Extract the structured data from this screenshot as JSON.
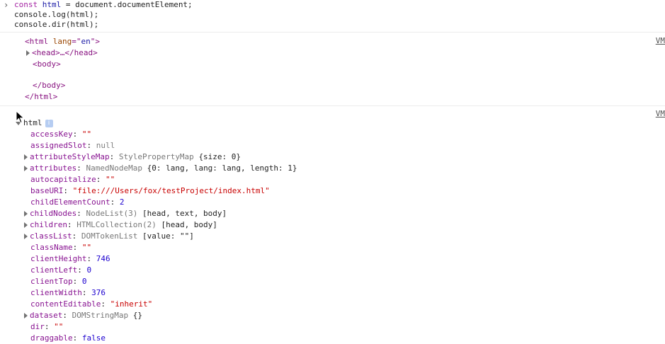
{
  "command": {
    "lines": [
      {
        "kw": "const",
        "name": "html",
        "rest": " = document.documentElement;"
      },
      {
        "text": "console.log(html);"
      },
      {
        "text": "console.dir(html);"
      }
    ]
  },
  "source_link": "VM",
  "log": {
    "rows": [
      {
        "open": "<",
        "tag": "html",
        "attr": "lang",
        "eq": "=\"",
        "val": "en",
        "close": "\">"
      },
      {
        "head": "<head>…</head>"
      },
      {
        "body_open": "<body>"
      },
      {
        "blank": ""
      },
      {
        "body_close": "</body>"
      },
      {
        "html_close": "</html>"
      }
    ]
  },
  "dir": {
    "root": "html",
    "info_badge": "i",
    "props": [
      {
        "name": "accessKey",
        "value": "\"\"",
        "kind": "str",
        "expand": false
      },
      {
        "name": "assignedSlot",
        "value": "null",
        "kind": "nul",
        "expand": false
      },
      {
        "name": "attributeStyleMap",
        "type": "StylePropertyMap",
        "value": "{size: 0}",
        "kind": "obj",
        "expand": true
      },
      {
        "name": "attributes",
        "type": "NamedNodeMap",
        "value": "{0: lang, lang: lang, length: 1}",
        "kind": "obj",
        "expand": true
      },
      {
        "name": "autocapitalize",
        "value": "\"\"",
        "kind": "str",
        "expand": false
      },
      {
        "name": "baseURI",
        "value": "\"file:///Users/fox/testProject/index.html\"",
        "kind": "str",
        "expand": false
      },
      {
        "name": "childElementCount",
        "value": "2",
        "kind": "num",
        "expand": false
      },
      {
        "name": "childNodes",
        "type": "NodeList(3)",
        "value": "[head, text, body]",
        "kind": "obj",
        "expand": true
      },
      {
        "name": "children",
        "type": "HTMLCollection(2)",
        "value": "[head, body]",
        "kind": "obj",
        "expand": true
      },
      {
        "name": "classList",
        "type": "DOMTokenList",
        "value": "[value: \"\"]",
        "kind": "obj",
        "expand": true
      },
      {
        "name": "className",
        "value": "\"\"",
        "kind": "str",
        "expand": false
      },
      {
        "name": "clientHeight",
        "value": "746",
        "kind": "num",
        "expand": false
      },
      {
        "name": "clientLeft",
        "value": "0",
        "kind": "num",
        "expand": false
      },
      {
        "name": "clientTop",
        "value": "0",
        "kind": "num",
        "expand": false
      },
      {
        "name": "clientWidth",
        "value": "376",
        "kind": "num",
        "expand": false
      },
      {
        "name": "contentEditable",
        "value": "\"inherit\"",
        "kind": "str",
        "expand": false
      },
      {
        "name": "dataset",
        "type": "DOMStringMap",
        "value": "{}",
        "kind": "obj",
        "expand": true
      },
      {
        "name": "dir",
        "value": "\"\"",
        "kind": "str",
        "expand": false
      },
      {
        "name": "draggable",
        "value": "false",
        "kind": "num",
        "expand": false
      }
    ]
  }
}
